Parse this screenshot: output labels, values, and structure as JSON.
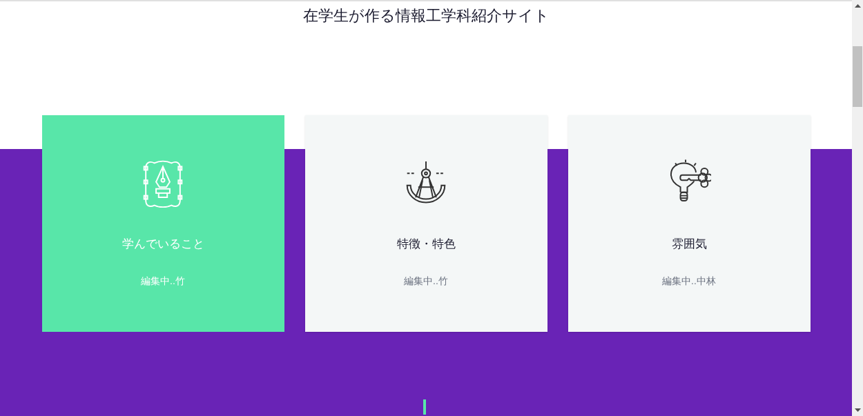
{
  "header": {
    "title": "在学生が作る情報工学科紹介サイト"
  },
  "cards": [
    {
      "kind": "pen",
      "title": "学んでいること",
      "note": "編集中..竹",
      "selected": true
    },
    {
      "kind": "compass",
      "title": "特徴・特色",
      "note": "編集中..竹",
      "selected": false
    },
    {
      "kind": "bulb",
      "title": "雰囲気",
      "note": "編集中..中林",
      "selected": false
    }
  ]
}
